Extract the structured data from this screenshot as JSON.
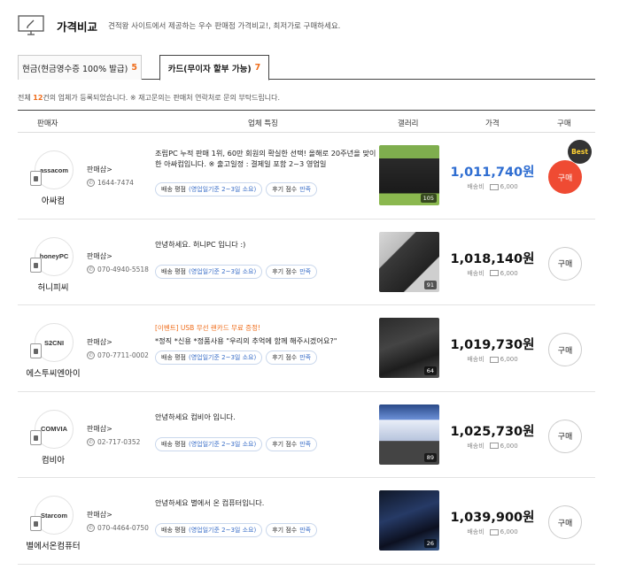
{
  "header": {
    "icon": "monitor-edit-icon",
    "title": "가격비교",
    "description": "견적왕 사이트에서 제공하는 우수 판매점 가격비교!, 최저가로 구매하세요."
  },
  "tabs": [
    {
      "label": "현금(현금영수증 100% 발급)",
      "count": "5",
      "active": false
    },
    {
      "label": "카드(무이자 할부 가능)",
      "count": "7",
      "active": true
    }
  ],
  "summary": {
    "prefix": "전체 ",
    "count": "12",
    "suffix": "건의 업체가 등록되었습니다.   ※ 재고문의는 판매처 연락처로 문의 부탁드립니다."
  },
  "columns": {
    "seller": "판매자",
    "feature": "업체 특징",
    "gallery": "갤러리",
    "price": "가격",
    "buy": "구매"
  },
  "chip_labels": {
    "delivery": "배송 평점",
    "delivery_value": "(영업일기준 2~3일 소요)",
    "review": "후기 점수",
    "review_value": "만족"
  },
  "seller_info_label": "판매샵>",
  "ship_label": "배송비",
  "buy_label": "구매",
  "best_label": "Best",
  "sellers": [
    {
      "name": "아싸컴",
      "logo": "assacom",
      "phone": "1644-7474",
      "event": "",
      "feature": "조립PC 누적 판매 1위, 60만 회원의 확실한 선택! 올해로 20주년을 맞이한 아싸컴입니다. ※ 출고일정 : 결제일 포함 2~3 영업일",
      "gallery_count": "105",
      "price": "1,011,740원",
      "ship": "6,000",
      "best": true
    },
    {
      "name": "허니피씨",
      "logo": "honeyPC",
      "phone": "070-4940-5518",
      "event": "",
      "feature": "안녕하세요. 허니PC 입니다 :)",
      "gallery_count": "91",
      "price": "1,018,140원",
      "ship": "6,000",
      "best": false
    },
    {
      "name": "에스투씨엔아이",
      "logo": "S2CNI",
      "phone": "070-7711-0002",
      "event": "[이벤트] USB 무선 랜카드 무료 증정!",
      "feature": "*정직 *신용 *정품사용 \"우리의 추억에 함께 해주시겠어요?\"",
      "gallery_count": "64",
      "price": "1,019,730원",
      "ship": "6,000",
      "best": false
    },
    {
      "name": "컴비아",
      "logo": "COMVIA",
      "phone": "02-717-0352",
      "event": "",
      "feature": "안녕하세요 컴비아 입니다.",
      "gallery_count": "89",
      "price": "1,025,730원",
      "ship": "6,000",
      "best": false
    },
    {
      "name": "별에서온컴퓨터",
      "logo": "Starcom",
      "phone": "070-4464-0750",
      "event": "",
      "feature": "안녕하세요 별에서 온 컴퓨터입니다.",
      "gallery_count": "26",
      "price": "1,039,900원",
      "ship": "6,000",
      "best": false
    }
  ],
  "colors": {
    "accent_orange": "#ef6c1a",
    "best_red": "#ef4b33",
    "price_blue": "#2e6dd1"
  }
}
